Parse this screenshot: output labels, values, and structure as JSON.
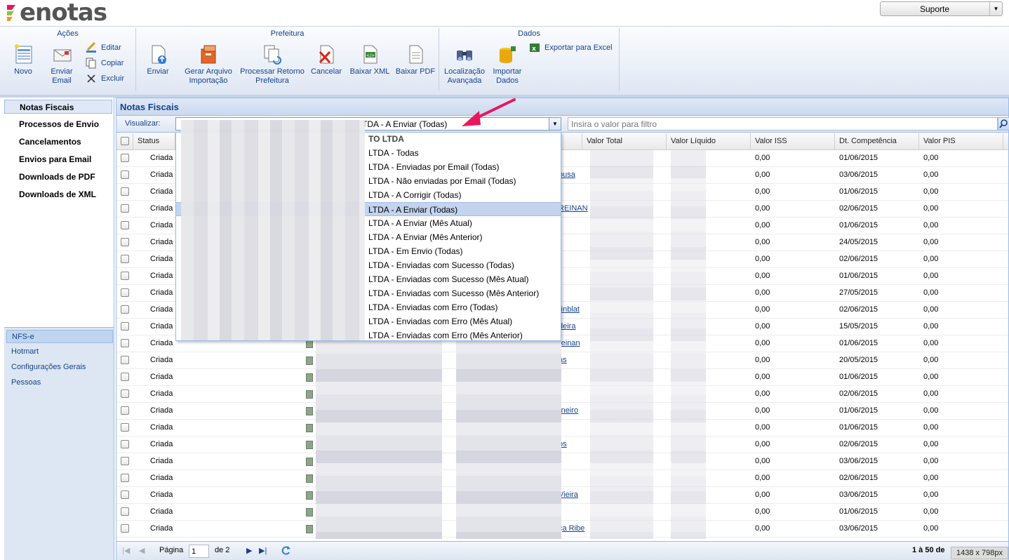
{
  "app": {
    "logo_text": "enotas",
    "support_label": "Suporte"
  },
  "ribbon": {
    "groups": {
      "acoes": "Ações",
      "prefeitura": "Prefeitura",
      "dados": "Dados"
    },
    "buttons": {
      "novo": "Novo",
      "enviar_email": "Enviar Email",
      "editar": "Editar",
      "copiar": "Copiar",
      "excluir": "Excluir",
      "enviar": "Enviar",
      "gerar_arquivo": "Gerar Arquivo Importação",
      "processar_retorno": "Processar Retorno Prefeitura",
      "cancelar": "Cancelar",
      "baixar_xml": "Baixar XML",
      "baixar_pdf": "Baixar PDF",
      "localizacao": "Localização Avançada",
      "importar": "Importar Dados",
      "exportar_excel": "Exportar para Excel"
    }
  },
  "sidebar": {
    "items": [
      "Notas Fiscais",
      "Processos de Envio",
      "Cancelamentos",
      "Envios para Email",
      "Downloads de PDF",
      "Downloads de XML"
    ],
    "modules": [
      "NFS-e",
      "Hotmart",
      "Configurações Gerais",
      "Pessoas"
    ]
  },
  "panel": {
    "title": "Notas Fiscais",
    "view_label": "Visualizar:",
    "view_value": "TDA - A Enviar (Todas)",
    "filter_placeholder": "Insira o valor para filtro"
  },
  "grid": {
    "columns": {
      "status": "Status",
      "valor_total": "Valor Total",
      "valor_liquido": "Valor Líquido",
      "valor_iss": "Valor ISS",
      "dt_competencia": "Dt. Competência",
      "valor_pis": "Valor PIS"
    },
    "rows": [
      {
        "status": "Criada",
        "link": "",
        "iss": "0,00",
        "dt": "01/06/2015",
        "pis": "0,00"
      },
      {
        "status": "Criada",
        "link": "ousa",
        "iss": "0,00",
        "dt": "03/06/2015",
        "pis": "0,00"
      },
      {
        "status": "Criada",
        "link": "",
        "iss": "0,00",
        "dt": "01/06/2015",
        "pis": "0,00"
      },
      {
        "status": "Criada",
        "link": "REINAN",
        "iss": "0,00",
        "dt": "02/06/2015",
        "pis": "0,00"
      },
      {
        "status": "Criada",
        "link": "",
        "iss": "0,00",
        "dt": "01/06/2015",
        "pis": "0,00"
      },
      {
        "status": "Criada",
        "link": "",
        "iss": "0,00",
        "dt": "24/05/2015",
        "pis": "0,00"
      },
      {
        "status": "Criada",
        "link": "",
        "iss": "0,00",
        "dt": "02/06/2015",
        "pis": "0,00"
      },
      {
        "status": "Criada",
        "link": "",
        "iss": "0,00",
        "dt": "01/06/2015",
        "pis": "0,00"
      },
      {
        "status": "Criada",
        "link": "",
        "iss": "0,00",
        "dt": "27/05/2015",
        "pis": "0,00"
      },
      {
        "status": "Criada",
        "link": "rinblat",
        "iss": "0,00",
        "dt": "02/06/2015",
        "pis": "0,00"
      },
      {
        "status": "Criada",
        "link": "deira",
        "iss": "0,00",
        "dt": "15/05/2015",
        "pis": "0,00"
      },
      {
        "status": "Criada",
        "link": "reinan",
        "iss": "0,00",
        "dt": "01/06/2015",
        "pis": "0,00"
      },
      {
        "status": "Criada",
        "link": "as",
        "iss": "0,00",
        "dt": "20/05/2015",
        "pis": "0,00"
      },
      {
        "status": "Criada",
        "link": "",
        "iss": "0,00",
        "dt": "01/06/2015",
        "pis": "0,00"
      },
      {
        "status": "Criada",
        "link": "",
        "iss": "0,00",
        "dt": "02/06/2015",
        "pis": "0,00"
      },
      {
        "status": "Criada",
        "link": "rneiro",
        "iss": "0,00",
        "dt": "01/06/2015",
        "pis": "0,00"
      },
      {
        "status": "Criada",
        "link": "",
        "iss": "0,00",
        "dt": "01/06/2015",
        "pis": "0,00"
      },
      {
        "status": "Criada",
        "link": "os",
        "iss": "0,00",
        "dt": "02/06/2015",
        "pis": "0,00"
      },
      {
        "status": "Criada",
        "link": "",
        "iss": "0,00",
        "dt": "03/06/2015",
        "pis": "0,00"
      },
      {
        "status": "Criada",
        "link": "",
        "iss": "0,00",
        "dt": "02/06/2015",
        "pis": "0,00"
      },
      {
        "status": "Criada",
        "link": "Vieira",
        "iss": "0,00",
        "dt": "03/06/2015",
        "pis": "0,00"
      },
      {
        "status": "Criada",
        "link": "",
        "iss": "0,00",
        "dt": "01/06/2015",
        "pis": "0,00"
      },
      {
        "status": "Criada",
        "link": "ça Ribe",
        "iss": "0,00",
        "dt": "03/06/2015",
        "pis": "0,00"
      }
    ]
  },
  "pager": {
    "page_label": "Página",
    "page_value": "1",
    "of_label": "de 2",
    "range_label": "1 à 50 de"
  },
  "dropdown": {
    "options": [
      "TO LTDA",
      "LTDA - Todas",
      "LTDA - Enviadas por Email (Todas)",
      "LTDA - Não enviadas por Email (Todas)",
      "LTDA - A Corrigir (Todas)",
      "LTDA - A Enviar (Todas)",
      "LTDA - A Enviar (Mês Atual)",
      "LTDA - A Enviar (Mês Anterior)",
      "LTDA - Em Envio (Todas)",
      "LTDA - Enviadas com Sucesso (Todas)",
      "LTDA - Enviadas com Sucesso (Mês Atual)",
      "LTDA - Enviadas com Sucesso (Mês Anterior)",
      "LTDA - Enviadas com Erro (Todas)",
      "LTDA - Enviadas com Erro (Mês Atual)",
      "LTDA - Enviadas com Erro (Mês Anterior)"
    ],
    "selected_index": 5
  },
  "overlay": {
    "size_badge": "1438 x 798px"
  },
  "colors": {
    "accent": "#15428b",
    "arrow": "#e8175d",
    "border": "#99bbe8"
  }
}
